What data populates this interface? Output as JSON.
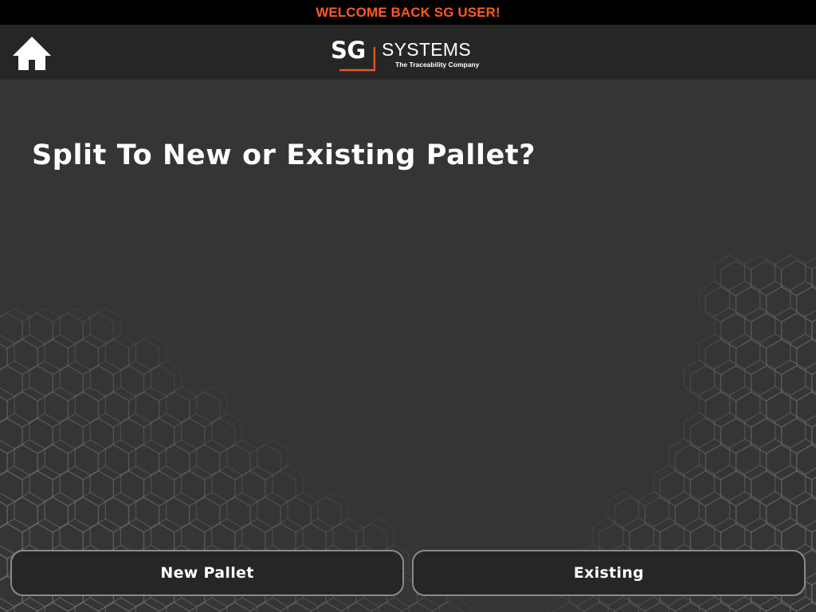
{
  "welcome": {
    "text": "WELCOME BACK SG USER!",
    "color": "#ff5a1f"
  },
  "header": {
    "home_icon": "home-icon",
    "logo": {
      "mark": "SG",
      "name": "SYSTEMS",
      "tagline": "The Traceability Company",
      "accent": "#e8562a"
    }
  },
  "prompt": {
    "title": "Split To New or Existing Pallet?"
  },
  "actions": {
    "new_label": "New Pallet",
    "existing_label": "Existing"
  },
  "colors": {
    "background": "#353535",
    "header": "#262626",
    "button_fill": "#262626",
    "button_border": "#8a8a8a"
  }
}
